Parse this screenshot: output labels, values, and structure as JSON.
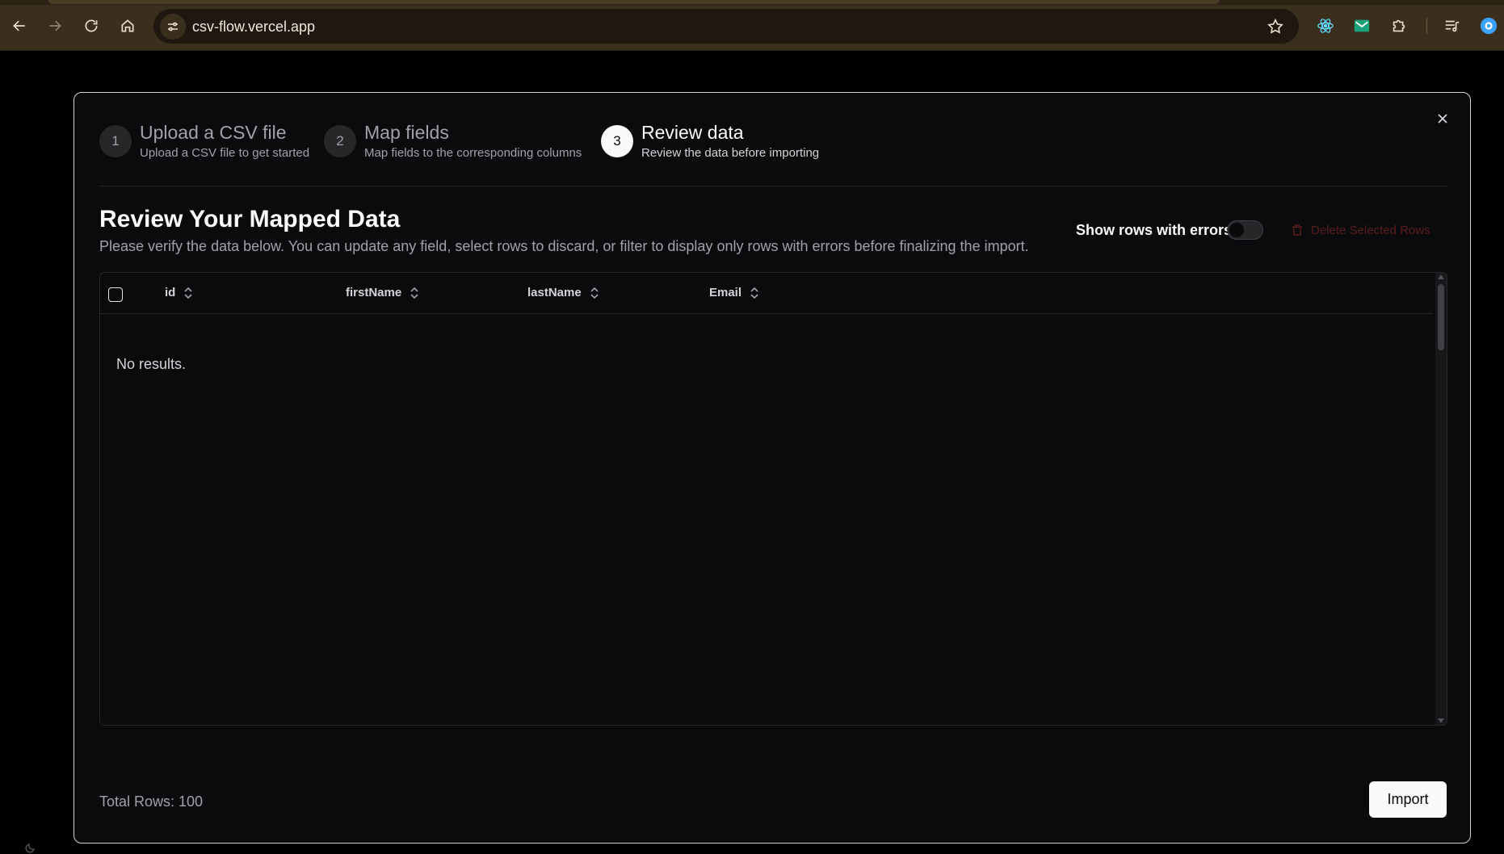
{
  "browser": {
    "url": "csv-flow.vercel.app",
    "icons": [
      "back-arrow-icon",
      "forward-arrow-icon",
      "reload-icon",
      "home-icon",
      "site-info-icon",
      "bookmark-star-icon",
      "react-devtools-icon",
      "mail-extension-icon",
      "puzzle-extensions-icon",
      "reading-list-icon",
      "profile-avatar-icon"
    ]
  },
  "modal": {
    "steps": [
      {
        "number": "1",
        "title": "Upload a CSV file",
        "description": "Upload a CSV file to get started",
        "active": false
      },
      {
        "number": "2",
        "title": "Map fields",
        "description": "Map fields to the corresponding columns",
        "active": false
      },
      {
        "number": "3",
        "title": "Review data",
        "description": "Review the data before importing",
        "active": true
      }
    ],
    "heading": "Review Your Mapped Data",
    "subheading": "Please verify the data below. You can update any field, select rows to discard, or filter to display only rows with errors before finalizing the import.",
    "filter_label": "Show rows with errors",
    "filter_on": false,
    "delete_label": "Delete Selected Rows",
    "table": {
      "columns": [
        "id",
        "firstName",
        "lastName",
        "Email"
      ],
      "empty_message": "No results."
    },
    "total_rows": "Total Rows: 100",
    "import_label": "Import"
  },
  "colors": {
    "background": "#000000",
    "modal_bg": "#0b0b0d",
    "chrome_bg": "#3a2e1c",
    "accent_text": "#fafafa",
    "muted_text": "#a1a1aa",
    "delete_disabled": "#5a1d1d"
  }
}
